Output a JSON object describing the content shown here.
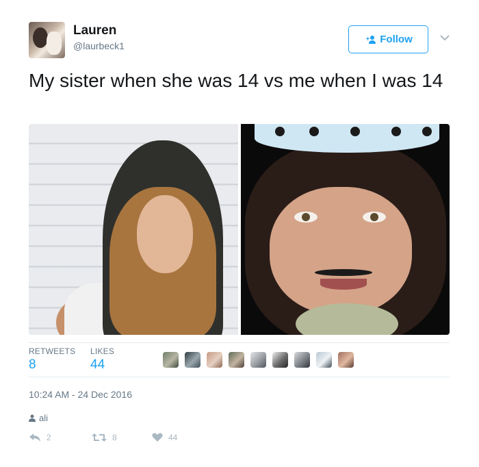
{
  "user": {
    "name": "Lauren",
    "handle": "@laurbeck1"
  },
  "follow": {
    "label": "Follow"
  },
  "tweet": {
    "text": "My sister when she was 14 vs me when I was 14"
  },
  "stats": {
    "retweets_label": "RETWEETS",
    "retweets_value": "8",
    "likes_label": "LIKES",
    "likes_value": "44"
  },
  "likers": [
    {
      "icon": "liker-avatar"
    },
    {
      "icon": "liker-avatar"
    },
    {
      "icon": "liker-avatar"
    },
    {
      "icon": "liker-avatar"
    },
    {
      "icon": "liker-avatar"
    },
    {
      "icon": "liker-avatar"
    },
    {
      "icon": "liker-avatar"
    },
    {
      "icon": "liker-avatar"
    },
    {
      "icon": "liker-avatar"
    }
  ],
  "timestamp": "10:24 AM - 24 Dec 2016",
  "via": {
    "name": "ali"
  },
  "actions": {
    "reply_count": "2",
    "retweet_count": "8",
    "like_count": "44"
  },
  "colors": {
    "accent": "#1da1f2",
    "muted": "#657786",
    "action_gray": "#aab8c2"
  }
}
